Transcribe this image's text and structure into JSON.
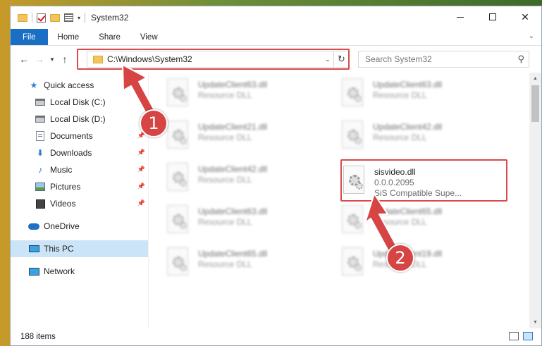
{
  "window": {
    "title": "System32",
    "controls": {
      "minimize": "",
      "maximize": "",
      "close": "✕"
    }
  },
  "ribbon": {
    "tabs": [
      "File",
      "Home",
      "Share",
      "View"
    ]
  },
  "address": {
    "path": "C:\\Windows\\System32",
    "search_placeholder": "Search System32"
  },
  "sidebar": {
    "items": [
      {
        "label": "Quick access",
        "icon": "star-icon"
      },
      {
        "label": "Local Disk (C:)",
        "icon": "drive-icon"
      },
      {
        "label": "Local Disk (D:)",
        "icon": "drive-icon"
      },
      {
        "label": "Documents",
        "icon": "documents-icon",
        "pinned": true
      },
      {
        "label": "Downloads",
        "icon": "downloads-icon",
        "pinned": true
      },
      {
        "label": "Music",
        "icon": "music-icon",
        "pinned": true
      },
      {
        "label": "Pictures",
        "icon": "pictures-icon",
        "pinned": true
      },
      {
        "label": "Videos",
        "icon": "videos-icon",
        "pinned": true
      },
      {
        "label": "OneDrive",
        "icon": "onedrive-icon"
      },
      {
        "label": "This PC",
        "icon": "this-pc-icon",
        "selected": true
      },
      {
        "label": "Network",
        "icon": "network-icon"
      }
    ]
  },
  "files": [
    {
      "name": "UpdateClient63.dll",
      "desc": "Resource DLL"
    },
    {
      "name": "UpdateClient63.dll",
      "desc": "Resource DLL"
    },
    {
      "name": "UpdateClient21.dll",
      "desc": "Resource DLL"
    },
    {
      "name": "UpdateClient42.dll",
      "desc": "Resource DLL"
    },
    {
      "name": "UpdateClient42.dll",
      "desc": "Resource DLL"
    },
    {
      "name": "sisvideo.dll",
      "version": "0.0.0.2095",
      "desc": "SiS Compatible Supe...",
      "selected": true
    },
    {
      "name": "UpdateClient63.dll",
      "desc": "Resource DLL"
    },
    {
      "name": "UpdateClient65.dll",
      "desc": "Resource DLL"
    },
    {
      "name": "UpdateClient65.dll",
      "desc": "Resource DLL"
    },
    {
      "name": "UpdateClient19.dll",
      "desc": "Resource DLL"
    }
  ],
  "status": {
    "item_count": "188 items"
  },
  "annotations": {
    "badge1": "1",
    "badge2": "2",
    "color": "#d64444"
  }
}
